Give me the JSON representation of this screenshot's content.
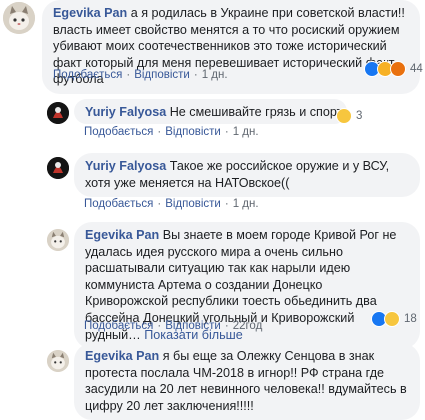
{
  "comments": [
    {
      "author": "Egevika Pan",
      "text": "а я родилась в Украине при советской власти!! власть имеет свойство менятся а то что росиский оружием убивают моих соотечественников это тоже исторический факт который для меня перевешивает исторический факт футбола",
      "like": "Подобається",
      "reply": "Відповісти",
      "time": "1 дн.",
      "reactions": [
        "like",
        "wow",
        "angry"
      ],
      "reaction_count": "44"
    },
    {
      "author": "Yuriy Falyosa",
      "text": "Не смешивайте грязь и спорт",
      "like": "Подобається",
      "reply": "Відповісти",
      "time": "1 дн.",
      "reactions": [
        "haha"
      ],
      "reaction_count": "3"
    },
    {
      "author": "Yuriy Falyosa",
      "text": "Такое же российское оружие и у ВСУ, хотя уже меняется на НАТОвское((",
      "like": "Подобається",
      "reply": "Відповісти",
      "time": "1 дн."
    },
    {
      "author": "Egevika Pan",
      "text": "Вы знаете в моем городе Кривой Рог не удалась идея русского мира а очень сильно расшатывали ситуацию так как нарыли идею коммуниста Артема о создании Донецко Криворожской республики тоесть обьединить два бассейна Донецкий угольный и Криворожский рудный…",
      "see_more": "Показати більше",
      "like": "Подобається",
      "reply": "Відповісти",
      "time": "22год",
      "reactions": [
        "like",
        "haha"
      ],
      "reaction_count": "18"
    },
    {
      "author": "Egevika Pan",
      "text": "я бы еще за Олежку Сенцова в знак протеста послала ЧМ-2018 в игнор!! РФ страна где засудили на 20 лет невинного человека!! вдумайтесь в цифру 20 лет заключения!!!!!"
    }
  ],
  "colors": {
    "author": "#385898",
    "bubble": "#f2f3f5",
    "meta": "#606770"
  }
}
